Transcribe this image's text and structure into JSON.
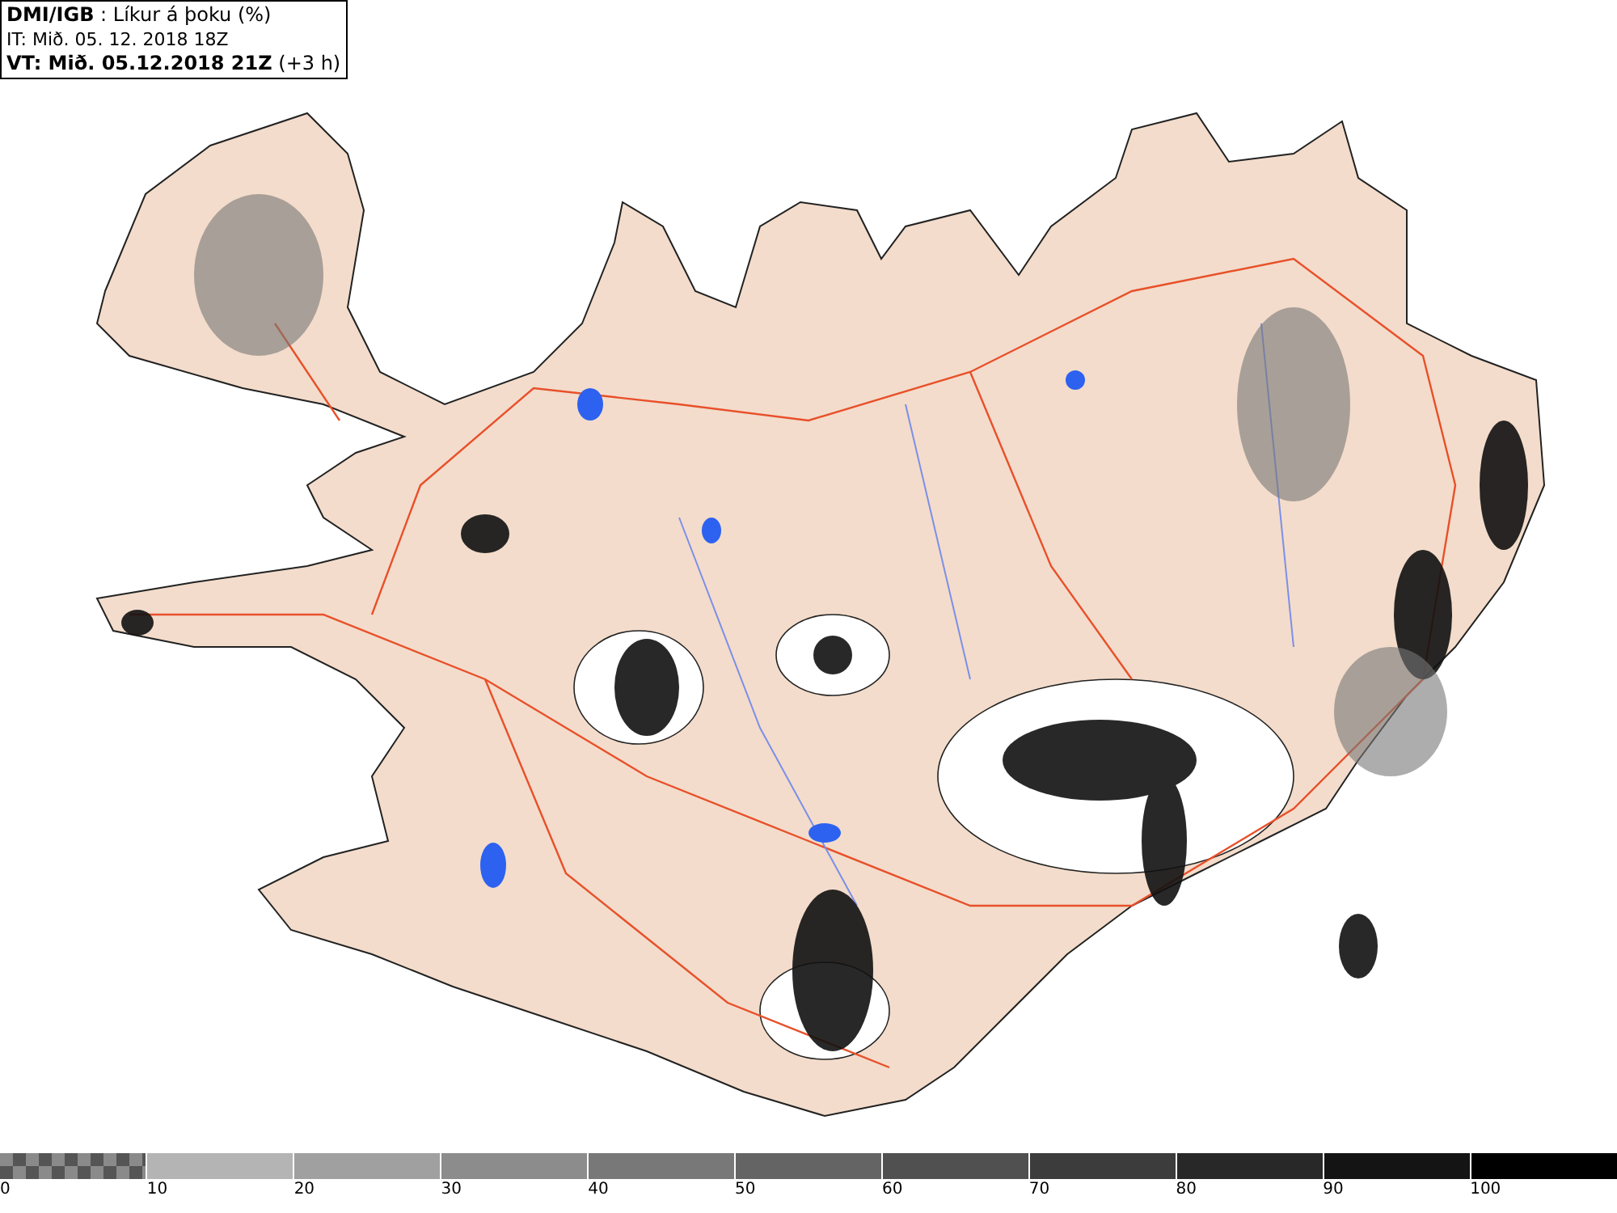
{
  "header": {
    "title": "**DMI/IGB** : Líkur á þoku (%)",
    "issue_time": "IT: Mið. 05. 12. 2018 18Z",
    "valid_time": "**VT: Mið. 05.12.2018 21Z** (+3 h)"
  },
  "legend": {
    "segments": [
      {
        "kind": "checker",
        "color": "#8a8a8a"
      },
      {
        "kind": "solid",
        "color": "#b4b4b4"
      },
      {
        "kind": "solid",
        "color": "#a0a0a0"
      },
      {
        "kind": "solid",
        "color": "#8c8c8c"
      },
      {
        "kind": "solid",
        "color": "#787878"
      },
      {
        "kind": "solid",
        "color": "#646464"
      },
      {
        "kind": "solid",
        "color": "#505050"
      },
      {
        "kind": "solid",
        "color": "#3c3c3c"
      },
      {
        "kind": "solid",
        "color": "#282828"
      },
      {
        "kind": "solid",
        "color": "#141414"
      },
      {
        "kind": "solid",
        "color": "#000000"
      }
    ],
    "labels": [
      "0",
      "10",
      "20",
      "30",
      "40",
      "50",
      "60",
      "70",
      "80",
      "90",
      "100"
    ]
  }
}
